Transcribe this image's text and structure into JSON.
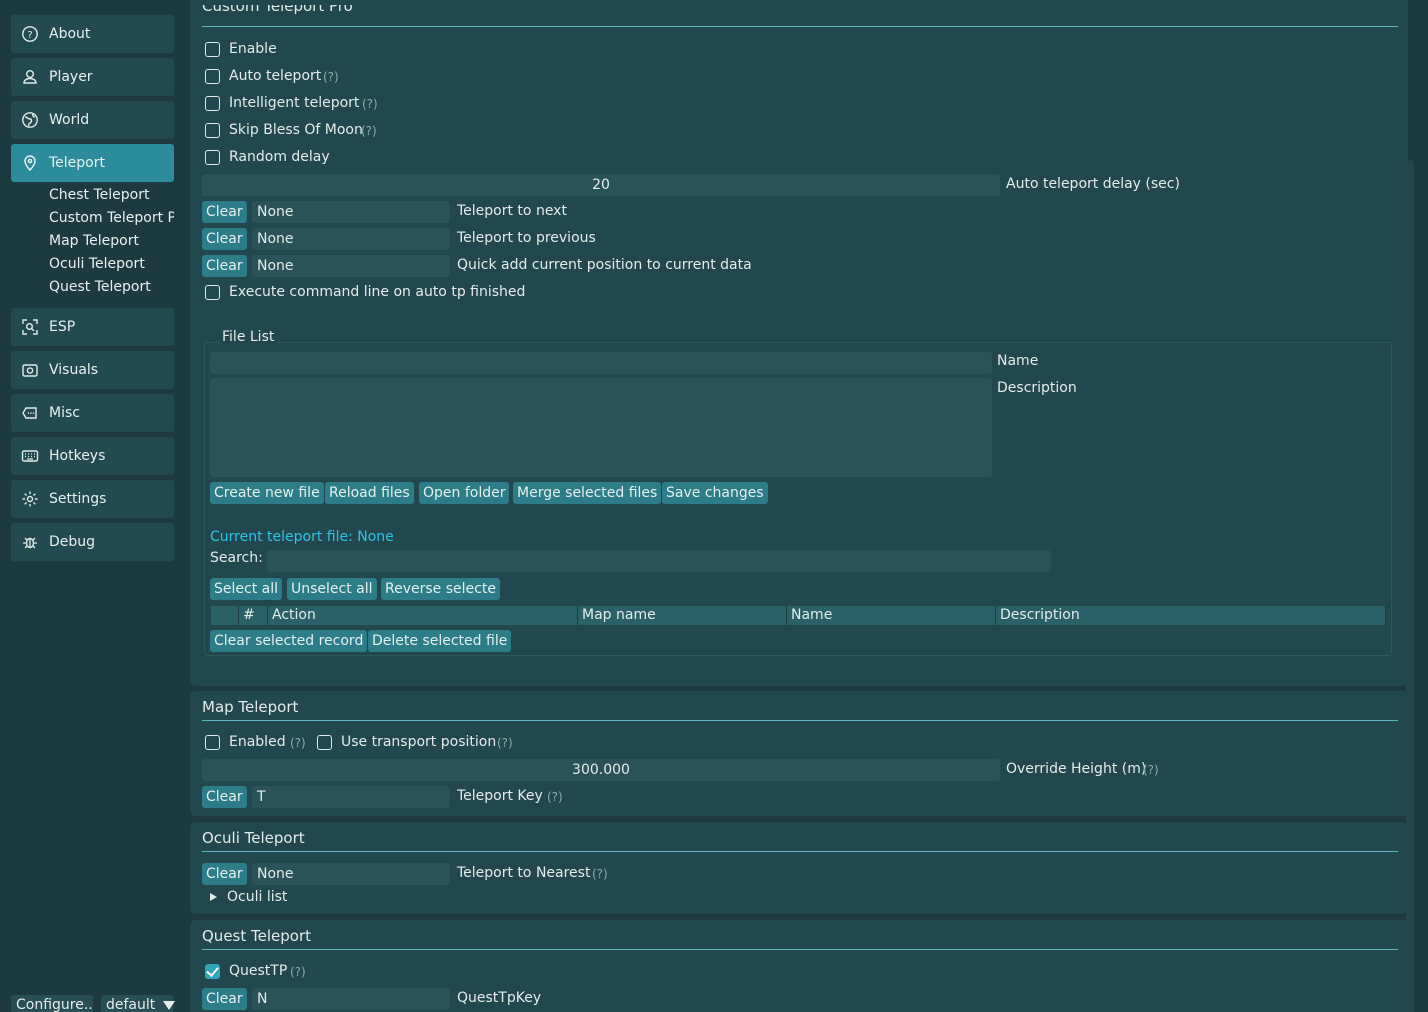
{
  "sidebar": {
    "items": [
      {
        "label": "About",
        "icon": "question-circle-icon"
      },
      {
        "label": "Player",
        "icon": "user-icon"
      },
      {
        "label": "World",
        "icon": "globe-icon"
      },
      {
        "label": "Teleport",
        "icon": "map-pin-icon"
      },
      {
        "label": "ESP",
        "icon": "scan-icon"
      },
      {
        "label": "Visuals",
        "icon": "camera-icon"
      },
      {
        "label": "Misc",
        "icon": "ellipsis-icon"
      },
      {
        "label": "Hotkeys",
        "icon": "keyboard-icon"
      },
      {
        "label": "Settings",
        "icon": "gear-icon"
      },
      {
        "label": "Debug",
        "icon": "bug-icon"
      }
    ],
    "teleport_sub": [
      "Chest Teleport",
      "Custom Teleport Pr",
      "Map Teleport",
      "Oculi Teleport",
      "Quest Teleport"
    ],
    "footer": {
      "configure": "Configure...",
      "profile": "default"
    }
  },
  "custom": {
    "title": "Custom Teleport Pro",
    "enable": "Enable",
    "auto_teleport": "Auto teleport",
    "intelligent": "Intelligent teleport",
    "skip_bless": "Skip Bless Of Moon",
    "random_delay": "Random delay",
    "hint": "(?)",
    "delay_value": "20",
    "delay_label": "Auto teleport delay (sec)",
    "clear": "Clear",
    "none": "None",
    "next_label": "Teleport to next",
    "prev_label": "Teleport to previous",
    "quick_label": "Quick add current position to current data",
    "exec_label": "Execute command line on auto tp finished"
  },
  "filelist": {
    "title": "File List",
    "name_label": "Name",
    "desc_label": "Description",
    "buttons": [
      "Create new file",
      "Reload files",
      "Open folder",
      "Merge selected files",
      "Save changes"
    ],
    "current_file": "Current teleport file: None",
    "search_label": "Search:",
    "select_buttons": [
      "Select all",
      "Unselect all",
      "Reverse selecte"
    ],
    "columns": [
      "#",
      "Action",
      "Map name",
      "Name",
      "Description"
    ],
    "bottom_buttons": [
      "Clear selected record",
      "Delete selected file"
    ]
  },
  "map": {
    "title": "Map Teleport",
    "enabled": "Enabled",
    "use_transport": "Use transport position",
    "height_value": "300.000",
    "height_label": "Override Height (m)",
    "key_value": "T",
    "key_label": "Teleport Key"
  },
  "oculi": {
    "title": "Oculi Teleport",
    "nearest_value": "None",
    "nearest_label": "Teleport to Nearest",
    "list_label": "Oculi list"
  },
  "quest": {
    "title": "Quest Teleport",
    "questtp": "QuestTP",
    "key_value": "N",
    "key_label": "QuestTpKey"
  },
  "colors": {
    "accent": "#2c8c9c",
    "link": "#2ec4e6",
    "background": "#1c3a40"
  }
}
